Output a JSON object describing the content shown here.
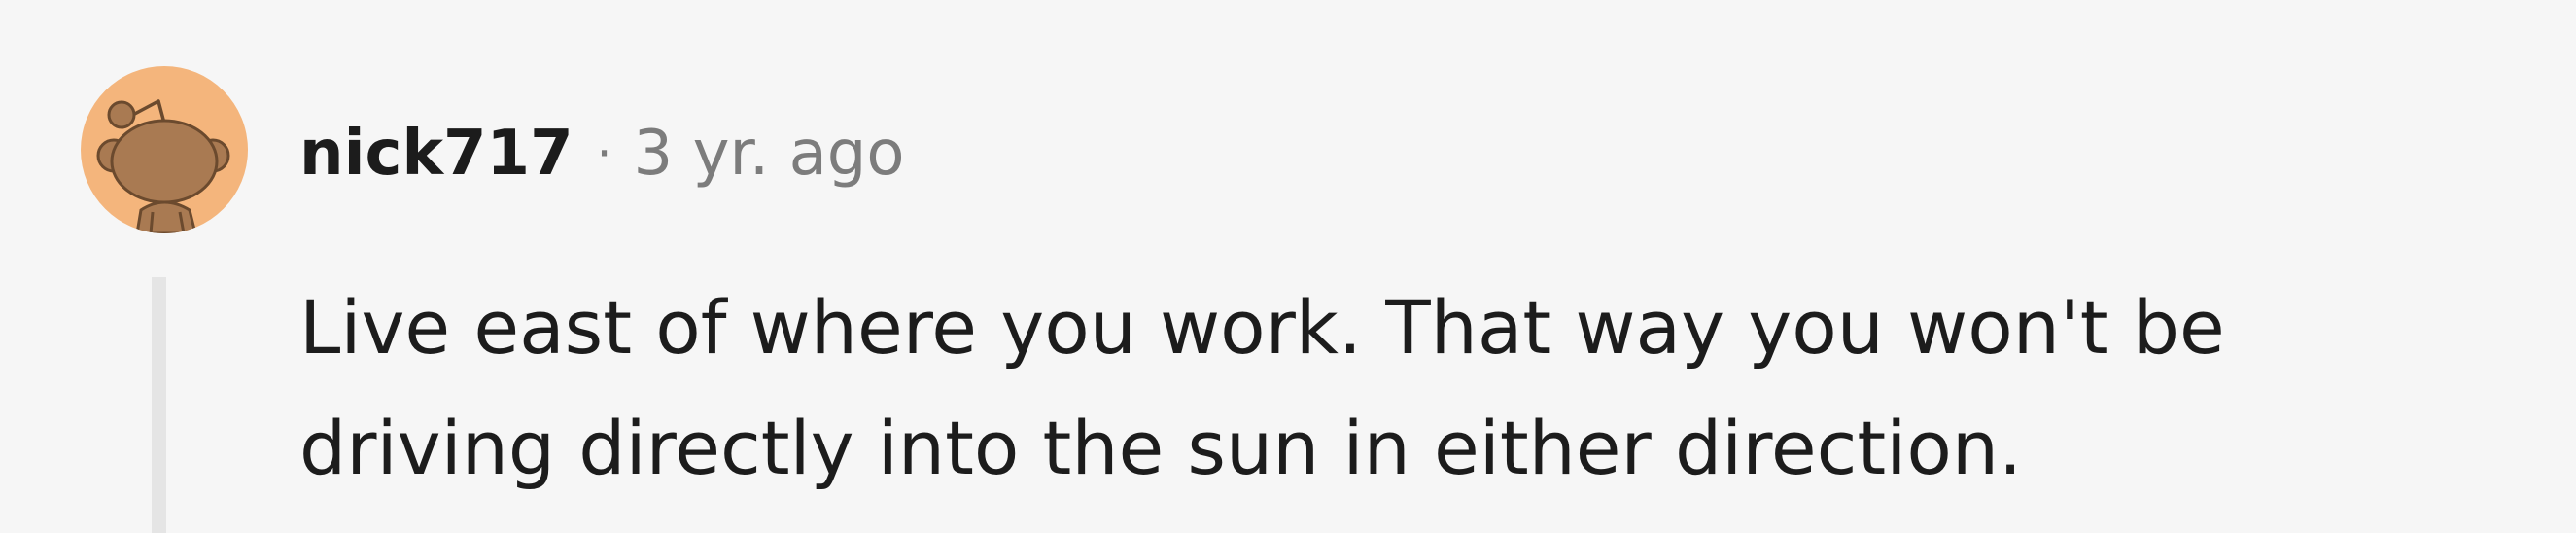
{
  "comment": {
    "author": "nick717",
    "separator": "·",
    "timestamp": "3 yr. ago",
    "body_lines": [
      "Live east of where you work. That way you won't be",
      "driving directly into the sun in either direction."
    ]
  },
  "avatar": {
    "icon": "snoo-avatar-icon",
    "background_color": "#f4b57c",
    "figure_color": "#a97a52"
  }
}
